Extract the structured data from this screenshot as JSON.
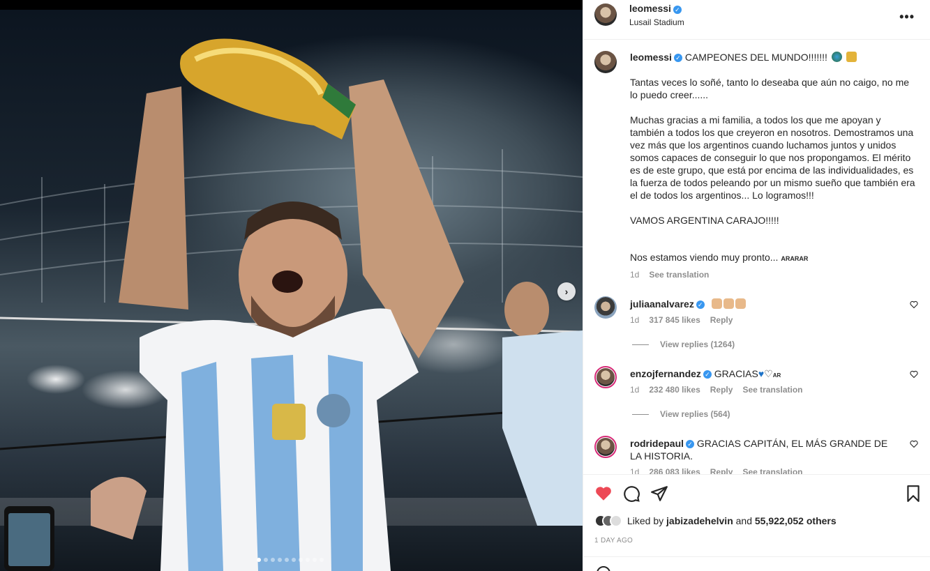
{
  "post": {
    "username": "leomessi",
    "location": "Lusail Stadium",
    "verified_mark": "✓",
    "more_icon": "•••"
  },
  "caption": {
    "username": "leomessi",
    "headline": "CAMPEONES DEL MUNDO!!!!!!!",
    "text": "Tantas veces lo soñé, tanto lo deseaba que aún no caigo, no me lo puedo creer......\n\nMuchas gracias a mi familia, a todos los que me apoyan y también a todos los que creyeron en nosotros. Demostramos una vez más que los argentinos cuando luchamos juntos y unidos somos capaces de conseguir lo que nos propongamos. El mérito es de este grupo, que está por encima de las individualidades, es la fuerza de todos peleando por un mismo sueño que también era el de todos los argentinos... Lo logramos!!!\n\nVAMOS ARGENTINA CARAJO!!!!!",
    "closing": "Nos estamos viendo muy pronto...",
    "flag_label": "ARARAR",
    "time": "1d",
    "see_translation": "See translation"
  },
  "comments": [
    {
      "username": "julia analvarez",
      "display": "juliaanalvarez",
      "text": "",
      "time": "1d",
      "likes": "317 845 likes",
      "reply": "Reply",
      "see_translation": "",
      "view_replies": "View replies (1264)"
    },
    {
      "username": "enzojfernandez",
      "display": "enzojfernandez",
      "text": "GRACIAS",
      "flag_label": "AR",
      "time": "1d",
      "likes": "232 480 likes",
      "reply": "Reply",
      "see_translation": "See translation",
      "view_replies": "View replies (564)"
    },
    {
      "username": "rodridepaul",
      "display": "rodridepaul",
      "text": "GRACIAS CAPITÁN, EL MÁS GRANDE DE LA HISTORIA.",
      "time": "1d",
      "likes": "286 083 likes",
      "reply": "Reply",
      "see_translation": "See translation"
    }
  ],
  "actions": {
    "liked_by_prefix": "Liked by",
    "liked_by_user": "jabizadehelvin",
    "liked_by_and": "and",
    "others": "55,922,052 others",
    "timestamp": "1 DAY AGO"
  },
  "carousel": {
    "total_dots": 10,
    "active_dot": 1
  },
  "colors": {
    "heart": "#ed4956",
    "verified": "#3897f0",
    "secondary_text": "#8e8e8e"
  }
}
